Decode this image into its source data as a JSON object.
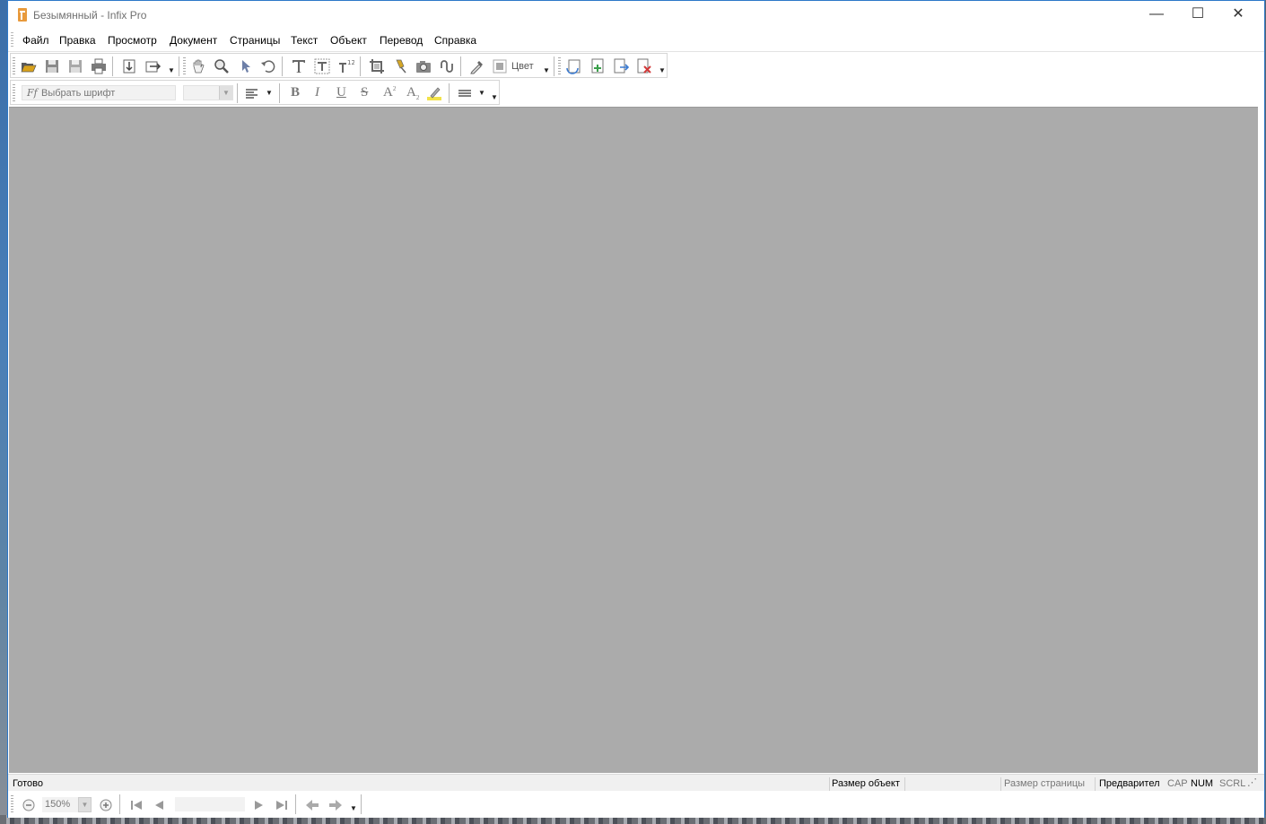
{
  "window": {
    "title": "Безымянный - Infix Pro",
    "controls": {
      "minimize": "—",
      "maximize": "☐",
      "close": "✕"
    }
  },
  "menu": [
    "Файл",
    "Правка",
    "Просмотр",
    "Документ",
    "Страницы",
    "Текст",
    "Объект",
    "Перевод",
    "Справка"
  ],
  "toolbar_main": {
    "color_label": "Цвет",
    "icons": [
      "open-icon",
      "save-icon",
      "save-as-icon",
      "print-icon",
      "import-icon",
      "export-icon",
      "hand-tool-icon",
      "zoom-tool-icon",
      "select-arrow-icon",
      "rotate-icon",
      "text-tool-icon",
      "text-box-icon",
      "text-format-icon",
      "crop-icon",
      "pin-icon",
      "camera-icon",
      "link-icon",
      "eyedropper-icon",
      "color-swatch-icon",
      "replace-page-icon",
      "insert-page-icon",
      "extract-page-icon",
      "delete-page-icon"
    ]
  },
  "toolbar_text": {
    "font_icon": "Ff",
    "font_placeholder": "Выбрать шрифт",
    "size_value": "",
    "bold": "B",
    "italic": "I",
    "underline": "U",
    "strike": "S",
    "superscript": "A",
    "superscript_mark": "2",
    "subscript": "A",
    "subscript_mark": "2"
  },
  "status": {
    "ready": "Готово",
    "object_size": "Размер объект",
    "page_size": "Размер страницы",
    "preview": "Предварител",
    "cap": "CAP",
    "num": "NUM",
    "scrl": "SCRL"
  },
  "navigation": {
    "zoom": "150%",
    "page": ""
  },
  "colors": {
    "canvas": "#ababab",
    "window_border": "#2d78c8",
    "statusbar": "#f0f0f0"
  }
}
